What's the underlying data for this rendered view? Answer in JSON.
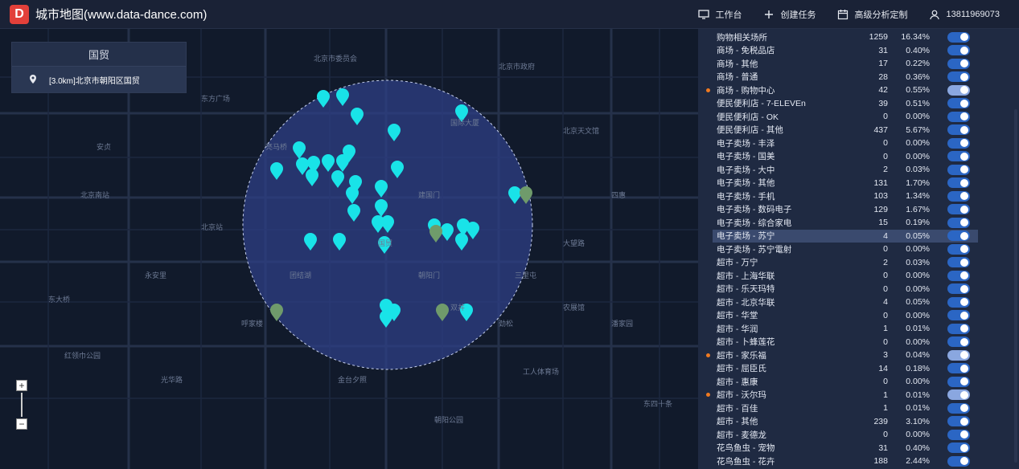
{
  "app": {
    "logo_letter": "D",
    "title": "城市地图(www.data-dance.com)"
  },
  "topbar": {
    "workbench": "工作台",
    "create_task": "创建任务",
    "advanced": "高级分析定制",
    "user": "13811969073"
  },
  "search": {
    "title": "国贸",
    "result": "[3.0km]北京市朝阳区国贸"
  },
  "map": {
    "labels": [
      "北京西单大悦城",
      "北京市委员会",
      "北京市政府",
      "国际大厦",
      "东方广场",
      "北京天文馆",
      "建国门",
      "国贸",
      "朝阳门",
      "三里屯",
      "北京南站",
      "北京站",
      "团结湖",
      "双井",
      "劲松",
      "大望路",
      "四惠",
      "永安里",
      "呼家楼",
      "金台夕照",
      "光华路",
      "东大桥",
      "潘家园",
      "工人体育场",
      "朝阳公园",
      "东四十条",
      "安贞",
      "亮马桥",
      "农展馆",
      "红领巾公园"
    ]
  },
  "categories": [
    {
      "name": "购物相关场所",
      "count": "1259",
      "pct": "16.34%",
      "on": false,
      "highlight": false
    },
    {
      "name": "商场 - 免税品店",
      "count": "31",
      "pct": "0.40%",
      "on": false,
      "highlight": false
    },
    {
      "name": "商场 - 其他",
      "count": "17",
      "pct": "0.22%",
      "on": false,
      "highlight": false
    },
    {
      "name": "商场 - 普通",
      "count": "28",
      "pct": "0.36%",
      "on": false,
      "highlight": false
    },
    {
      "name": "商场 - 购物中心",
      "count": "42",
      "pct": "0.55%",
      "on": true,
      "highlight": true
    },
    {
      "name": "便民便利店 - 7-ELEVEn",
      "count": "39",
      "pct": "0.51%",
      "on": false,
      "highlight": false
    },
    {
      "name": "便民便利店 - OK",
      "count": "0",
      "pct": "0.00%",
      "on": false,
      "highlight": false
    },
    {
      "name": "便民便利店 - 其他",
      "count": "437",
      "pct": "5.67%",
      "on": false,
      "highlight": false
    },
    {
      "name": "电子卖场 - 丰泽",
      "count": "0",
      "pct": "0.00%",
      "on": false,
      "highlight": false
    },
    {
      "name": "电子卖场 - 国美",
      "count": "0",
      "pct": "0.00%",
      "on": false,
      "highlight": false
    },
    {
      "name": "电子卖场 - 大中",
      "count": "2",
      "pct": "0.03%",
      "on": false,
      "highlight": false
    },
    {
      "name": "电子卖场 - 其他",
      "count": "131",
      "pct": "1.70%",
      "on": false,
      "highlight": false
    },
    {
      "name": "电子卖场 - 手机",
      "count": "103",
      "pct": "1.34%",
      "on": false,
      "highlight": false
    },
    {
      "name": "电子卖场 - 数码电子",
      "count": "129",
      "pct": "1.67%",
      "on": false,
      "highlight": false
    },
    {
      "name": "电子卖场 - 综合家电",
      "count": "15",
      "pct": "0.19%",
      "on": false,
      "highlight": false
    },
    {
      "name": "电子卖场 - 苏宁",
      "count": "4",
      "pct": "0.05%",
      "on": false,
      "highlight": false,
      "selected": true
    },
    {
      "name": "电子卖场 - 苏宁電射",
      "count": "0",
      "pct": "0.00%",
      "on": false,
      "highlight": false
    },
    {
      "name": "超市 - 万宁",
      "count": "2",
      "pct": "0.03%",
      "on": false,
      "highlight": false
    },
    {
      "name": "超市 - 上海华联",
      "count": "0",
      "pct": "0.00%",
      "on": false,
      "highlight": false
    },
    {
      "name": "超市 - 乐天玛特",
      "count": "0",
      "pct": "0.00%",
      "on": false,
      "highlight": false
    },
    {
      "name": "超市 - 北京华联",
      "count": "4",
      "pct": "0.05%",
      "on": false,
      "highlight": false
    },
    {
      "name": "超市 - 华堂",
      "count": "0",
      "pct": "0.00%",
      "on": false,
      "highlight": false
    },
    {
      "name": "超市 - 华润",
      "count": "1",
      "pct": "0.01%",
      "on": false,
      "highlight": false
    },
    {
      "name": "超市 - 卜蜂莲花",
      "count": "0",
      "pct": "0.00%",
      "on": false,
      "highlight": false
    },
    {
      "name": "超市 - 家乐福",
      "count": "3",
      "pct": "0.04%",
      "on": true,
      "highlight": true
    },
    {
      "name": "超市 - 屈臣氏",
      "count": "14",
      "pct": "0.18%",
      "on": false,
      "highlight": false
    },
    {
      "name": "超市 - 惠康",
      "count": "0",
      "pct": "0.00%",
      "on": false,
      "highlight": false
    },
    {
      "name": "超市 - 沃尔玛",
      "count": "1",
      "pct": "0.01%",
      "on": true,
      "highlight": true
    },
    {
      "name": "超市 - 百佳",
      "count": "1",
      "pct": "0.01%",
      "on": false,
      "highlight": false
    },
    {
      "name": "超市 - 其他",
      "count": "239",
      "pct": "3.10%",
      "on": false,
      "highlight": false
    },
    {
      "name": "超市 - 麦德龙",
      "count": "0",
      "pct": "0.00%",
      "on": false,
      "highlight": false
    },
    {
      "name": "花鸟鱼虫 - 宠物",
      "count": "31",
      "pct": "0.40%",
      "on": false,
      "highlight": false
    },
    {
      "name": "花鸟鱼虫 - 花卉",
      "count": "188",
      "pct": "2.44%",
      "on": false,
      "highlight": false
    }
  ],
  "colors": {
    "marker": "#19e3e8",
    "circle_fill": "#2d3f86",
    "toggle_off": "#2b66c4",
    "toggle_on": "#8aa7e0",
    "highlight_dot": "#f07a20"
  }
}
